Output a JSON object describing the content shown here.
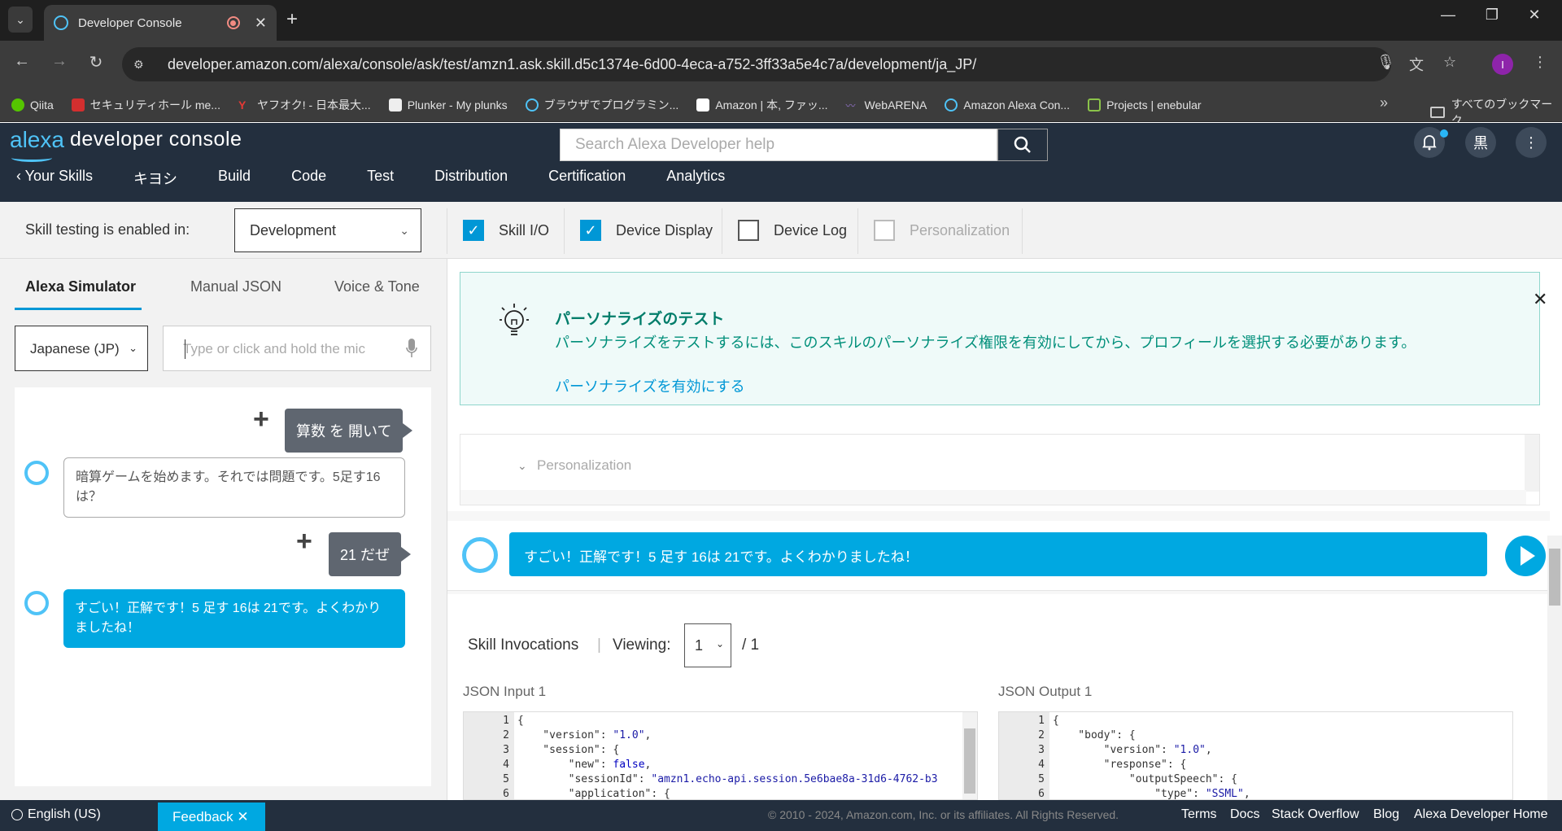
{
  "browser": {
    "tab_title": "Developer Console",
    "url": "developer.amazon.com/alexa/console/ask/test/amzn1.ask.skill.d5c1374e-6d00-4eca-a752-3ff33a5e4c7a/development/ja_JP/",
    "profile_initial": "I",
    "bookmarks": [
      {
        "label": "Qiita",
        "color": "#55c500"
      },
      {
        "label": "セキュリティホール me...",
        "color": "#d32f2f"
      },
      {
        "label": "ヤフオク! - 日本最大...",
        "color": "#e53935"
      },
      {
        "label": "Plunker - My plunks",
        "color": "#eeeeee"
      },
      {
        "label": "ブラウザでプログラミン...",
        "color": "#4fc3f7"
      },
      {
        "label": "Amazon | 本, ファッ...",
        "color": "#ffffff"
      },
      {
        "label": "WebARENA",
        "color": "#7e57c2"
      },
      {
        "label": "Amazon Alexa Con...",
        "color": "#4fc3f7"
      },
      {
        "label": "Projects | enebular",
        "color": "#8bc34a"
      }
    ],
    "all_bookmarks": "すべてのブックマーク"
  },
  "header": {
    "logo": "alexa",
    "title": "developer console",
    "search_placeholder": "Search Alexa Developer help",
    "avatar": "黒",
    "nav": [
      {
        "label": "Your Skills"
      },
      {
        "label": "キヨシ"
      },
      {
        "label": "Build"
      },
      {
        "label": "Code"
      },
      {
        "label": "Test"
      },
      {
        "label": "Distribution"
      },
      {
        "label": "Certification"
      },
      {
        "label": "Analytics"
      }
    ]
  },
  "toolbar": {
    "label": "Skill testing is enabled in:",
    "environment": "Development",
    "options": [
      {
        "label": "Skill I/O",
        "checked": true
      },
      {
        "label": "Device Display",
        "checked": true
      },
      {
        "label": "Device Log",
        "checked": false
      },
      {
        "label": "Personalization",
        "checked": false
      }
    ]
  },
  "simulator": {
    "tabs": [
      "Alexa Simulator",
      "Manual JSON",
      "Voice & Tone"
    ],
    "language": "Japanese (JP)",
    "input_placeholder": "Type or click and hold the mic",
    "messages": [
      {
        "from": "user",
        "text": "算数 を 開いて"
      },
      {
        "from": "alexa",
        "text": "暗算ゲームを始めます。それでは問題です。5足す16は？"
      },
      {
        "from": "user",
        "text": "21 だぜ"
      },
      {
        "from": "alexa",
        "text": "すごい！正解です！5 足す 16は 21です。よくわかりましたね！"
      }
    ]
  },
  "notice": {
    "title": "パーソナライズのテスト",
    "body": "パーソナライズをテストするには、このスキルのパーソナライズ権限を有効にしてから、プロフィールを選択する必要があります。",
    "link": "パーソナライズを有効にする"
  },
  "personalization_panel": {
    "label": "Personalization"
  },
  "response": {
    "text": "すごい！正解です！5 足す 16は 21です。よくわかりましたね！"
  },
  "invocations": {
    "title": "Skill Invocations",
    "separator": "|",
    "viewing_label": "Viewing:",
    "page": "1",
    "total": "/ 1",
    "input_label": "JSON Input 1",
    "output_label": "JSON Output 1"
  },
  "json_input_lines": [
    "1",
    "2",
    "3",
    "4",
    "5",
    "6"
  ],
  "json_output_lines": [
    "1",
    "2",
    "3",
    "4",
    "5",
    "6"
  ],
  "footer": {
    "language": "English (US)",
    "feedback": "Feedback",
    "copyright": "© 2010 - 2024, Amazon.com, Inc. or its affiliates. All Rights Reserved.",
    "links": [
      "Terms",
      "Docs",
      "Stack Overflow",
      "Blog",
      "Alexa Developer Home"
    ]
  }
}
